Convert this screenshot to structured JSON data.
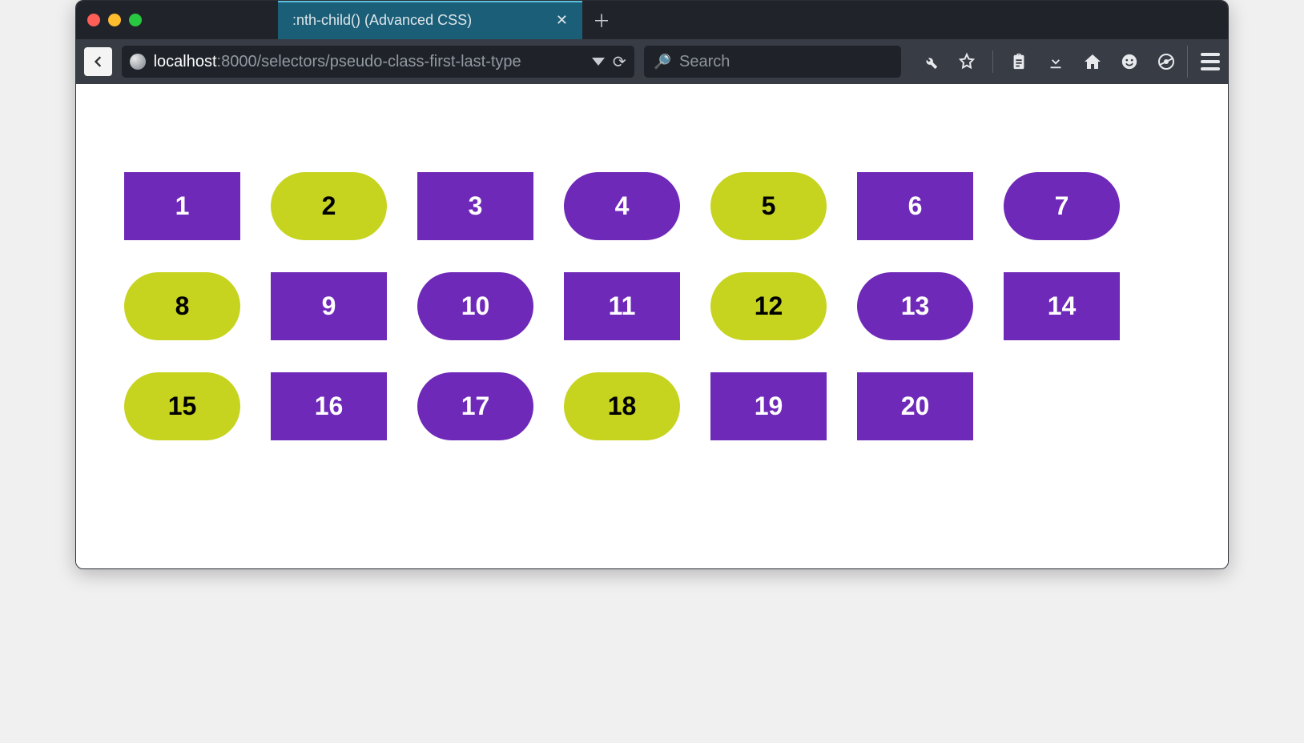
{
  "window": {
    "tab_title": ":nth-child() (Advanced CSS)",
    "url_host": "localhost",
    "url_rest": ":8000/selectors/pseudo-class-first-last-type",
    "search_placeholder": "Search"
  },
  "colors": {
    "purple": "#6f29b8",
    "lime": "#c6d420"
  },
  "boxes": [
    {
      "label": "1",
      "style": "rect"
    },
    {
      "label": "2",
      "style": "pill-lime"
    },
    {
      "label": "3",
      "style": "rect"
    },
    {
      "label": "4",
      "style": "pill-purple"
    },
    {
      "label": "5",
      "style": "pill-lime"
    },
    {
      "label": "6",
      "style": "rect"
    },
    {
      "label": "7",
      "style": "pill-purple"
    },
    {
      "label": "8",
      "style": "pill-lime"
    },
    {
      "label": "9",
      "style": "rect"
    },
    {
      "label": "10",
      "style": "pill-purple"
    },
    {
      "label": "11",
      "style": "rect"
    },
    {
      "label": "12",
      "style": "pill-lime"
    },
    {
      "label": "13",
      "style": "pill-purple"
    },
    {
      "label": "14",
      "style": "rect"
    },
    {
      "label": "15",
      "style": "pill-lime"
    },
    {
      "label": "16",
      "style": "rect"
    },
    {
      "label": "17",
      "style": "pill-purple"
    },
    {
      "label": "18",
      "style": "pill-lime"
    },
    {
      "label": "19",
      "style": "rect"
    },
    {
      "label": "20",
      "style": "rect"
    }
  ]
}
